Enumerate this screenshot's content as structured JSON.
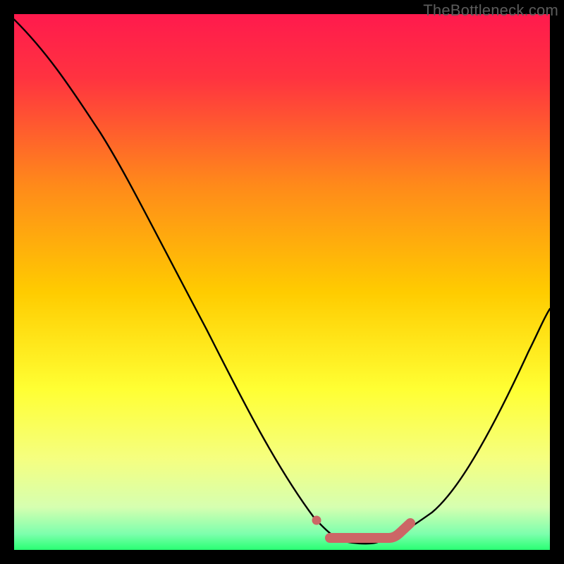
{
  "watermark": "TheBottleneck.com",
  "chart_data": {
    "type": "line",
    "title": "",
    "xlabel": "",
    "ylabel": "",
    "xlim": [
      0,
      100
    ],
    "ylim": [
      0,
      100
    ],
    "grid": false,
    "legend": false,
    "background_gradient": {
      "top": "#ff1a4d",
      "mid1": "#ff9c00",
      "mid2": "#ffff33",
      "mid3": "#f3ff9c",
      "bottom": "#29ff73"
    },
    "black_curve": {
      "description": "V-shaped bottleneck curve",
      "points": [
        [
          0,
          99
        ],
        [
          7,
          92
        ],
        [
          16,
          78
        ],
        [
          26,
          60
        ],
        [
          36,
          41
        ],
        [
          46,
          22
        ],
        [
          52,
          12
        ],
        [
          56,
          6
        ],
        [
          59,
          3
        ],
        [
          62,
          1.5
        ],
        [
          68,
          1.5
        ],
        [
          73,
          3
        ],
        [
          78,
          7
        ],
        [
          84,
          15
        ],
        [
          90,
          25
        ],
        [
          96,
          37
        ],
        [
          100,
          45
        ]
      ]
    },
    "highlight_band": {
      "color": "#cc6666",
      "description": "optimal / near-zero bottleneck range",
      "start_dot": [
        56.5,
        5.5
      ],
      "flat_segment": [
        [
          59,
          2.2
        ],
        [
          70,
          2.2
        ]
      ],
      "rising_segment": [
        [
          70,
          2.2
        ],
        [
          73.5,
          4.5
        ]
      ]
    }
  }
}
